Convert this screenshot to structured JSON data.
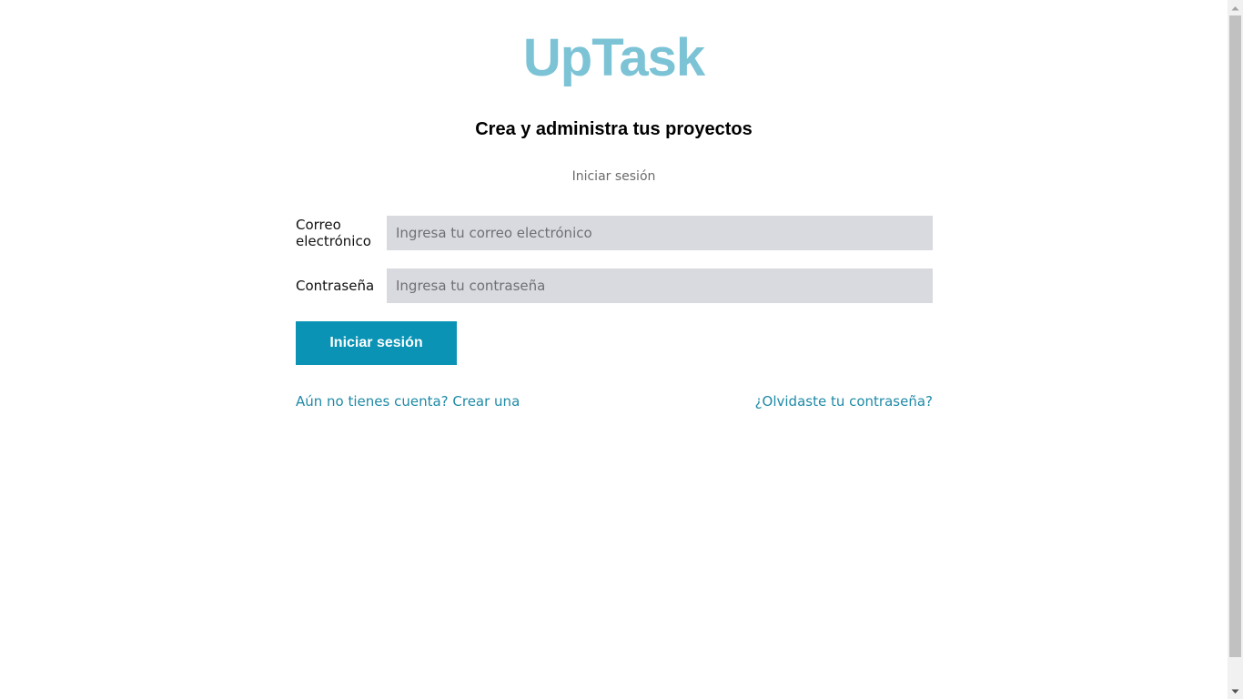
{
  "brand": {
    "logo_text": "UpTask",
    "tagline": "Crea y administra tus proyectos"
  },
  "page": {
    "subtitle": "Iniciar sesión"
  },
  "form": {
    "email": {
      "label": "Correo electrónico",
      "placeholder": "Ingresa tu correo electrónico",
      "value": ""
    },
    "password": {
      "label": "Contraseña",
      "placeholder": "Ingresa tu contraseña",
      "value": ""
    },
    "submit_label": "Iniciar sesión"
  },
  "links": {
    "register": "Aún no tienes cuenta? Crear una",
    "forgot_password": "¿Olvidaste tu contraseña?"
  },
  "colors": {
    "logo": "#7cc3d6",
    "accent": "#0a93b4",
    "link": "#1f8aa6",
    "input_background": "#d9dadf"
  },
  "icons": {
    "scroll_up": "scroll-up-arrow-icon",
    "scroll_down": "scroll-down-arrow-icon"
  }
}
